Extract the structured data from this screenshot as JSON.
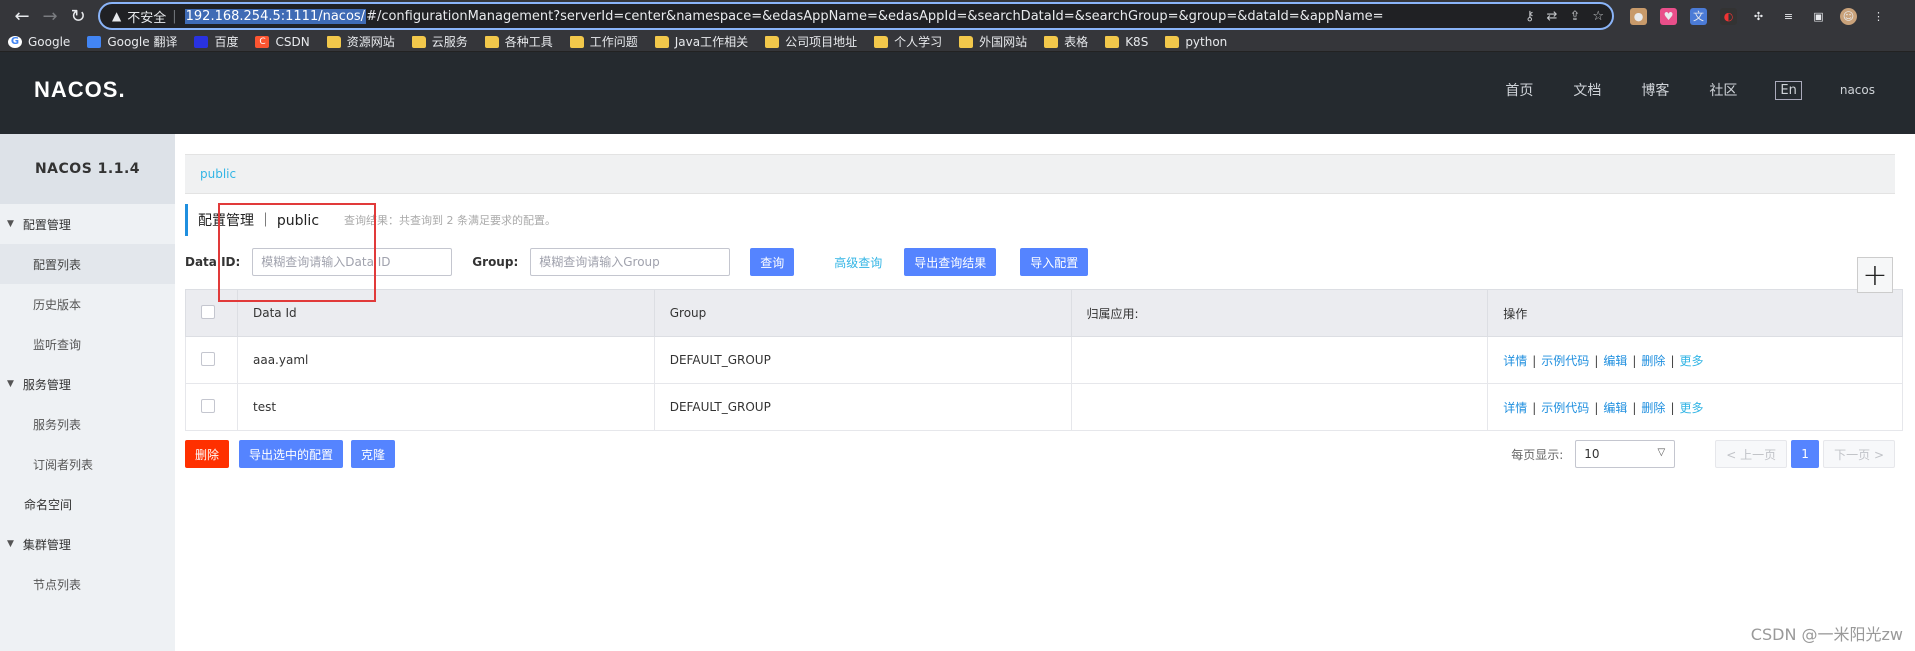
{
  "browser": {
    "insecure_label": "不安全",
    "url_host": "192.168.254.5:1111/nacos/",
    "url_rest": "#/configurationManagement?serverId=center&namespace=&edasAppName=&edasAppId=&searchDataId=&searchGroup=&group=&dataId=&appName=",
    "bookmarks": [
      {
        "label": "Google",
        "icon": "google-icon"
      },
      {
        "label": "Google 翻译",
        "icon": "translate-icon"
      },
      {
        "label": "百度",
        "icon": "baidu-icon"
      },
      {
        "label": "CSDN",
        "icon": "csdn-icon"
      },
      {
        "label": "资源网站",
        "icon": "folder-icon"
      },
      {
        "label": "云服务",
        "icon": "folder-icon"
      },
      {
        "label": "各种工具",
        "icon": "folder-icon"
      },
      {
        "label": "工作问题",
        "icon": "folder-icon"
      },
      {
        "label": "Java工作相关",
        "icon": "folder-icon"
      },
      {
        "label": "公司项目地址",
        "icon": "folder-icon"
      },
      {
        "label": "个人学习",
        "icon": "folder-icon"
      },
      {
        "label": "外国网站",
        "icon": "folder-icon"
      },
      {
        "label": "表格",
        "icon": "folder-icon"
      },
      {
        "label": "K8S",
        "icon": "folder-icon"
      },
      {
        "label": "python",
        "icon": "folder-icon"
      }
    ]
  },
  "header": {
    "logo": "NACOS.",
    "nav": [
      "首页",
      "文档",
      "博客",
      "社区"
    ],
    "lang": "En",
    "user": "nacos"
  },
  "sidebar": {
    "title": "NACOS 1.1.4",
    "config_group": "配置管理",
    "config_items": [
      "配置列表",
      "历史版本",
      "监听查询"
    ],
    "service_group": "服务管理",
    "service_items": [
      "服务列表",
      "订阅者列表"
    ],
    "namespace": "命名空间",
    "cluster_group": "集群管理",
    "cluster_items": [
      "节点列表"
    ]
  },
  "main": {
    "namespace_tab": "public",
    "title": "配置管理 ｜ public",
    "result_hint": "查询结果：共查询到 2 条满足要求的配置。",
    "data_id_label": "Data ID:",
    "data_id_placeholder": "模糊查询请输入Data ID",
    "group_label": "Group:",
    "group_placeholder": "模糊查询请输入Group",
    "search_btn": "查询",
    "advanced_link": "高级查询",
    "export_query_btn": "导出查询结果",
    "import_btn": "导入配置",
    "add_icon": "+"
  },
  "table": {
    "columns": [
      "Data Id",
      "Group",
      "归属应用:",
      "操作"
    ],
    "rows": [
      {
        "data_id": "aaa.yaml",
        "group": "DEFAULT_GROUP",
        "app": ""
      },
      {
        "data_id": "test",
        "group": "DEFAULT_GROUP",
        "app": ""
      }
    ],
    "ops": [
      "详情",
      "示例代码",
      "编辑",
      "删除",
      "更多"
    ]
  },
  "footer": {
    "delete_btn": "删除",
    "export_selected_btn": "导出选中的配置",
    "clone_btn": "克隆",
    "page_size_label": "每页显示:",
    "page_size": "10",
    "prev": "< 上一页",
    "current_page": "1",
    "next": "下一页 >"
  },
  "watermark": "CSDN @一米阳光zw"
}
